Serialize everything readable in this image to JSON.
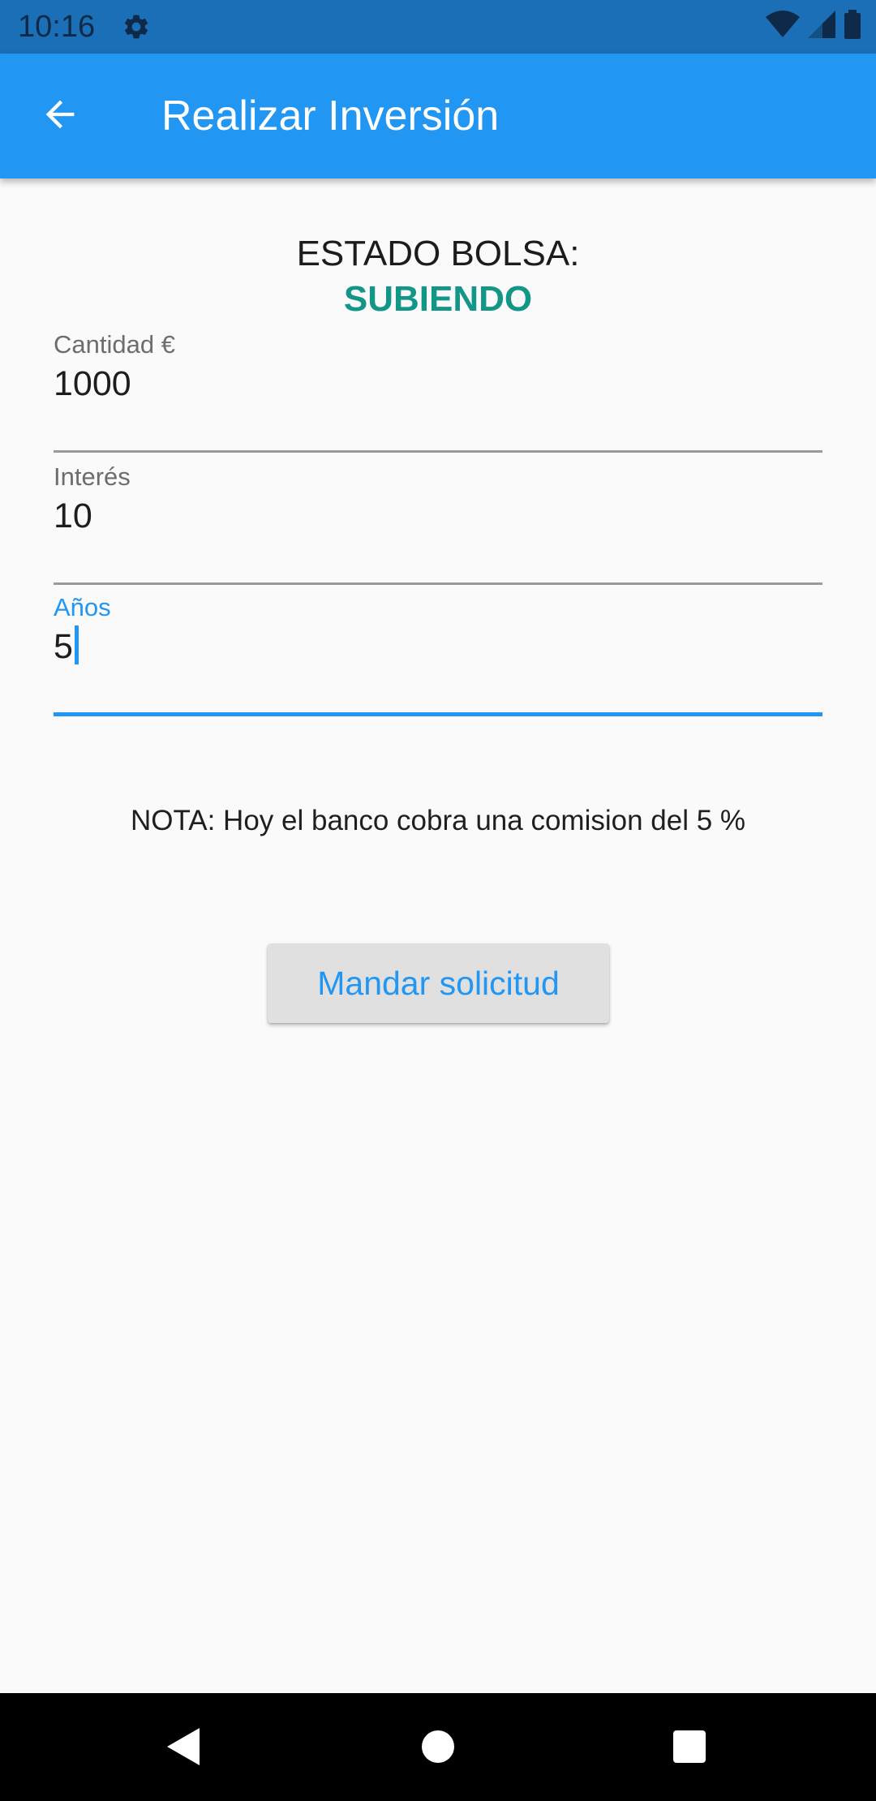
{
  "status_bar": {
    "time": "10:16",
    "icons": [
      "settings-icon",
      "wifi-icon",
      "signal-icon",
      "battery-icon"
    ]
  },
  "app_bar": {
    "title": "Realizar Inversión",
    "back_icon": "arrow-left-icon",
    "background_color": "#2196f3"
  },
  "market": {
    "label": "ESTADO BOLSA:",
    "status": "SUBIENDO",
    "status_color": "#129688"
  },
  "form": {
    "fields": [
      {
        "label": "Cantidad €",
        "value": "1000"
      },
      {
        "label": "Interés",
        "value": "10"
      },
      {
        "label": "Años",
        "value": "5"
      }
    ],
    "focused_field": "Años",
    "accent_color": "#2196f3"
  },
  "note": {
    "text": "NOTA: Hoy el banco cobra una comision del 5 %"
  },
  "actions": {
    "submit_label": "Mandar solicitud"
  },
  "nav_bar": {
    "icons": [
      "back-triangle-icon",
      "home-circle-icon",
      "recents-square-icon"
    ]
  }
}
